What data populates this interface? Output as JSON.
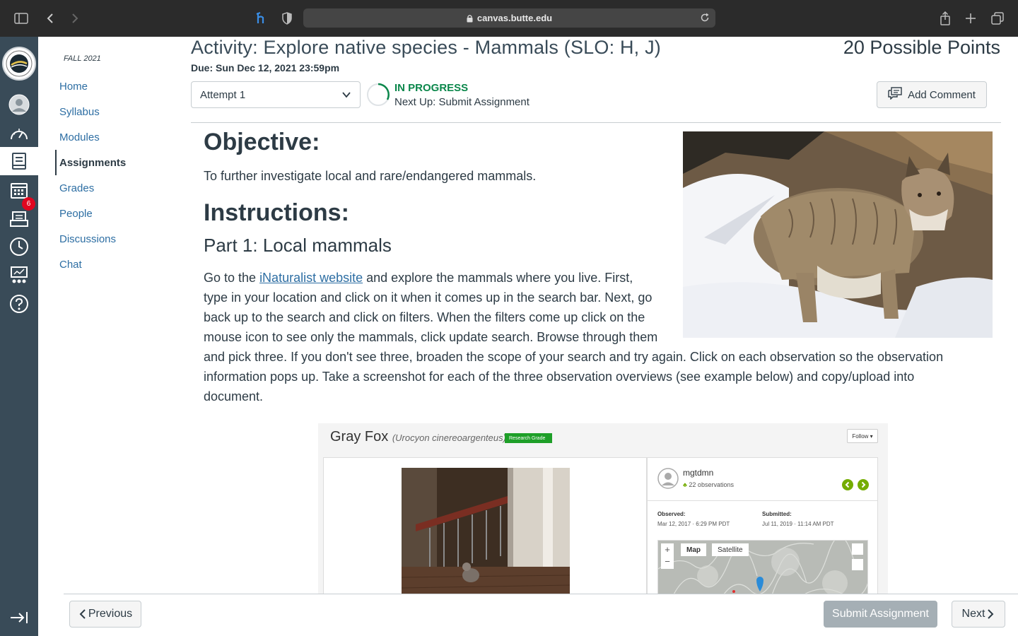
{
  "browser": {
    "url": "canvas.butte.edu"
  },
  "course_nav": {
    "term": "FALL 2021",
    "items": [
      {
        "label": "Home"
      },
      {
        "label": "Syllabus"
      },
      {
        "label": "Modules"
      },
      {
        "label": "Assignments",
        "active": true
      },
      {
        "label": "Grades"
      },
      {
        "label": "People"
      },
      {
        "label": "Discussions"
      },
      {
        "label": "Chat"
      }
    ]
  },
  "global_nav": {
    "icons": [
      "account-icon",
      "dashboard-icon",
      "courses-icon",
      "calendar-icon",
      "inbox-icon",
      "history-icon",
      "commons-icon",
      "help-icon"
    ],
    "inbox_badge": "6"
  },
  "assignment": {
    "title": "Activity: Explore native species - Mammals (SLO: H, J)",
    "points": "20 Possible Points",
    "due": "Due: Sun Dec 12, 2021 23:59pm",
    "attempt_label": "Attempt 1",
    "status": "IN PROGRESS",
    "next_up": "Next Up: Submit Assignment",
    "add_comment": "Add Comment"
  },
  "content": {
    "objective_heading": "Objective:",
    "objective_text": "To further investigate local and rare/endangered mammals.",
    "instructions_heading": "Instructions:",
    "part1_heading": "Part 1: Local mammals",
    "para_intro": "Go to the ",
    "link_text": "iNaturalist website",
    "line1_rest": " and explore the mammals where you live. First,",
    "line2": "type in your location and click on it when it comes up in the search bar. Next, go",
    "line3": "back up to the search and click on filters. When the filters come up click on the",
    "line4": "mouse icon to see only the mammals, click update search. Browse through them",
    "line5": "and pick three. If you don't see three, broaden the scope of your search and try again. Click on each observation so the observation",
    "line6": "information pops up. Take a screenshot for each of the three observation overviews (see example below) and copy/upload into",
    "line7": "document."
  },
  "inat_example": {
    "common_name": "Gray Fox",
    "scientific_name": "(Urocyon cinereoargenteus)",
    "grade": "Research Grade",
    "follow": "Follow ▾",
    "user": "mgtdmn",
    "observations": "22 observations",
    "observed_label": "Observed:",
    "observed_value": "Mar 12, 2017 · 6:29 PM PDT",
    "submitted_label": "Submitted:",
    "submitted_value": "Jul 11, 2019 · 11:14 AM PDT",
    "map_tab": "Map",
    "satellite_tab": "Satellite"
  },
  "footer": {
    "previous": "Previous",
    "submit": "Submit Assignment",
    "next": "Next"
  },
  "colors": {
    "link": "#2d6ea3",
    "status_green": "#0b874b",
    "nav_bg": "#394b58",
    "badge": "#e0061f"
  }
}
